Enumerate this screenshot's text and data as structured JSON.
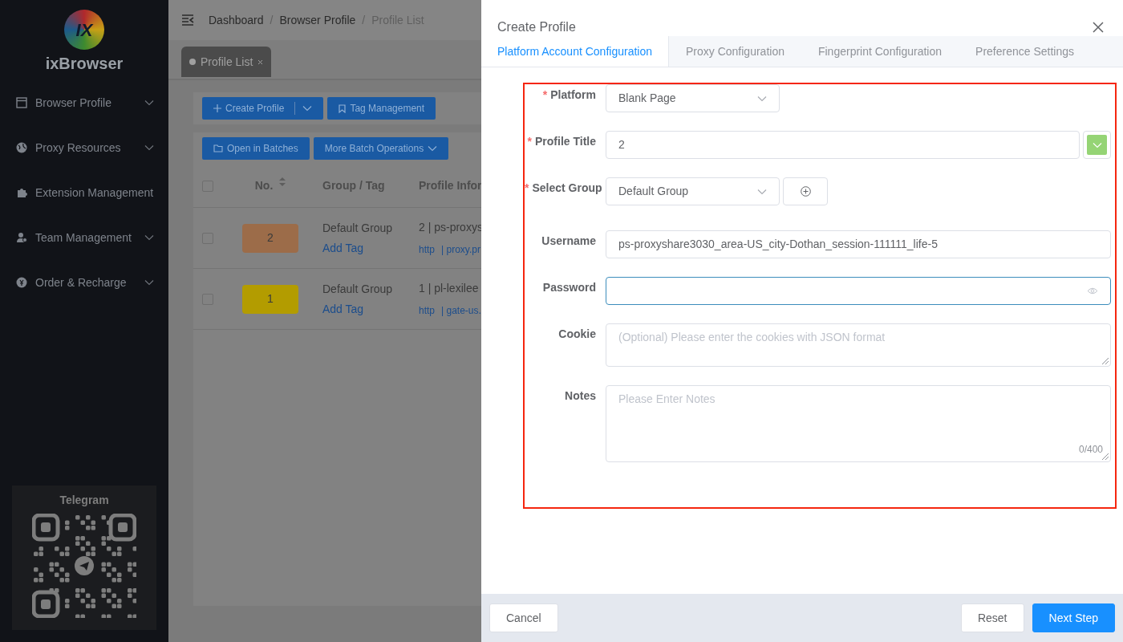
{
  "sidebar": {
    "logo_mark": "IX",
    "brand": "ixBrowser",
    "items": [
      {
        "label": "Browser Profile",
        "kind": "window",
        "expandable": true
      },
      {
        "label": "Proxy Resources",
        "kind": "globe",
        "expandable": true
      },
      {
        "label": "Extension Management",
        "kind": "puzzle",
        "expandable": false
      },
      {
        "label": "Team Management",
        "kind": "users",
        "expandable": true
      },
      {
        "label": "Order & Recharge",
        "kind": "coin",
        "expandable": true
      }
    ],
    "qr_card": {
      "title": "Telegram"
    }
  },
  "breadcrumb": [
    {
      "label": "Dashboard",
      "current": false
    },
    {
      "separator": "/",
      "label": "Browser Profile",
      "current": false
    },
    {
      "separator": "/",
      "label": "Profile List",
      "current": true
    }
  ],
  "page_tabs": [
    {
      "label": "Profile List",
      "selected": true
    }
  ],
  "toolbar": [
    {
      "label": "Create Profile",
      "kind": "split"
    },
    {
      "label": "Tag Management",
      "kind": "tag"
    }
  ],
  "batch_toolbar": [
    {
      "label": "Open in Batches",
      "kind": "folder"
    },
    {
      "label": "More Batch Operations",
      "kind": "dropdown"
    }
  ],
  "table": {
    "select_all_checked": false,
    "columns": [
      "No.",
      "Group / Tag",
      "Profile Infor"
    ],
    "rows": [
      {
        "checked": false,
        "number": "2",
        "color": "#9c6c49",
        "group": "Default Group",
        "tag_link": "Add Tag",
        "info": "2 | ps-proxys",
        "protocol": "http",
        "host": "| proxy.pr"
      },
      {
        "checked": false,
        "number": "1",
        "color": "#b39c00",
        "group": "Default Group",
        "tag_link": "Add Tag",
        "info": "1 |  pl-lexilee",
        "protocol": "http",
        "host": "| gate-us."
      }
    ]
  },
  "drawer": {
    "title": "Create Profile",
    "required_mark": "*",
    "tabs": [
      {
        "label": "Platform Account Configuration",
        "selected": true
      },
      {
        "label": "Proxy Configuration",
        "selected": false
      },
      {
        "label": "Fingerprint Configuration",
        "selected": false
      },
      {
        "label": "Preference Settings",
        "selected": false
      }
    ],
    "fields": [
      {
        "label": "Platform",
        "required": true,
        "kind": "select",
        "value": "Blank Page"
      },
      {
        "label": "Profile Title",
        "required": true,
        "kind": "input",
        "value": "2",
        "color": "#95d475"
      },
      {
        "label": "Select Group",
        "required": true,
        "kind": "select-add",
        "value": "Default Group"
      },
      {
        "label": "Username",
        "required": false,
        "kind": "input",
        "value": "ps-proxyshare3030_area-US_city-Dothan_session-111111_life-5"
      },
      {
        "label": "Password",
        "required": false,
        "kind": "password",
        "focused": true
      },
      {
        "label": "Cookie",
        "required": false,
        "kind": "textarea",
        "placeholder": "(Optional) Please enter the cookies with JSON format"
      },
      {
        "label": "Notes",
        "required": false,
        "kind": "textarea-count",
        "placeholder": "Please Enter Notes",
        "count": "0/400"
      }
    ],
    "footer": {
      "cancel": "Cancel",
      "reset": "Reset",
      "next": "Next Step"
    }
  }
}
